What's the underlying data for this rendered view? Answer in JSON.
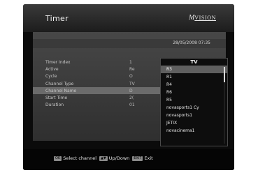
{
  "screen": {
    "title": "Timer",
    "logo_mark": "M",
    "logo_text": "VISION",
    "date_time": "28/05/2008 07:35"
  },
  "fields": [
    {
      "label": "Timer Index",
      "value": "1"
    },
    {
      "label": "Active",
      "value": "Re"
    },
    {
      "label": "Cycle",
      "value": "O"
    },
    {
      "label": "Channel Type",
      "value": "TV"
    },
    {
      "label": "Channel Name",
      "value": "D"
    },
    {
      "label": "Start Time",
      "value": "2("
    },
    {
      "label": "Duration",
      "value": "01"
    }
  ],
  "dropdown": {
    "header": "TV",
    "items": [
      "R3",
      "R1",
      "R4",
      "R6",
      "R5",
      "novasports1 Cy",
      "novasports1",
      "JETIX",
      "novacinema1"
    ],
    "selected_index": 0
  },
  "help_bar": {
    "select_key": "OK",
    "select_label": "Select channel",
    "updown_key": "▲▼",
    "updown_label": "Up/Down",
    "exit_key": "EXIT",
    "exit_label": "Exit"
  },
  "colors": {
    "background": "#0b0b0b",
    "panel": "#3a3a3a",
    "selection": "#6b6b6b",
    "text": "#c8c8c8"
  }
}
